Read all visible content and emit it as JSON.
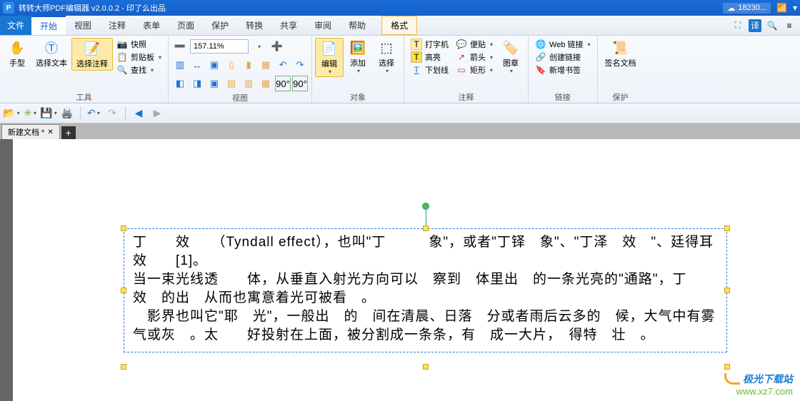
{
  "titlebar": {
    "app_initial": "P",
    "title": "转转大师PDF编辑器 v2.0.0.2 - 印了么出品",
    "cloud_text": "18230..."
  },
  "menu": {
    "file": "文件",
    "tabs": [
      "开始",
      "视图",
      "注释",
      "表单",
      "页面",
      "保护",
      "转换",
      "共享",
      "审阅",
      "帮助"
    ],
    "format": "格式"
  },
  "ribbon": {
    "tools_group": "工具",
    "hand": "手型",
    "select_text": "选择文本",
    "select_note": "选择注释",
    "snapshot": "快照",
    "clipboard": "剪贴板",
    "find": "查找",
    "view_group": "视图",
    "zoom_value": "157.11%",
    "object_group": "对象",
    "edit": "编辑",
    "add": "添加",
    "select": "选择",
    "annotate_group": "注释",
    "typewriter": "打字机",
    "highlight": "高亮",
    "underline": "下划线",
    "sticky": "便贴",
    "arrow": "箭头",
    "rect": "矩形",
    "stamp": "图章",
    "link_group": "链接",
    "web_link": "Web 链接",
    "create_link": "创建链接",
    "add_bookmark": "新增书签",
    "protect_group": "保护",
    "sign_doc": "签名文档"
  },
  "doc": {
    "tab_name": "新建文档 *"
  },
  "text": {
    "p1": "丁　　效　　（Tyndall effect），也叫\"丁　　　象\"，或者\"丁铎　象\"、\"丁泽　效　\"、廷得耳效　　[1]。",
    "p2": "当一束光线透　　体，从垂直入射光方向可以　察到　体里出　的一条光亮的\"通路\"，丁　　效　的出　从而也寓意着光可被看　。",
    "p3": "　影界也叫它\"耶　光\"，一般出　的　间在清晨、日落　分或者雨后云多的　候，大气中有雾气或灰　。太　　好投射在上面，被分割成一条条，有　成一大片，　得特　壮　。"
  },
  "watermark": {
    "line1": "极光下载站",
    "line2": "www.xz7.com"
  }
}
